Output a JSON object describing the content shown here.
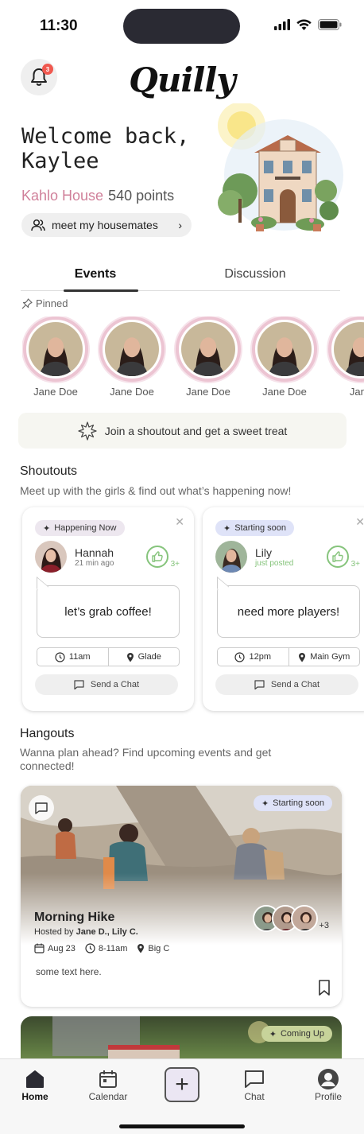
{
  "status": {
    "time": "11:30"
  },
  "header": {
    "logo": "Quilly",
    "notification_count": "3"
  },
  "welcome": {
    "greeting": "Welcome back, Kaylee",
    "house_name": "Kahlo House",
    "points": "540 points",
    "housemates_label": "meet my housemates"
  },
  "tabs": [
    {
      "label": "Events"
    },
    {
      "label": "Discussion"
    }
  ],
  "pinned": {
    "label": "Pinned",
    "people": [
      {
        "name": "Jane Doe"
      },
      {
        "name": "Jane Doe"
      },
      {
        "name": "Jane Doe"
      },
      {
        "name": "Jane Doe"
      },
      {
        "name": "Jane"
      }
    ]
  },
  "join_banner": "Join a shoutout and get a sweet treat",
  "shoutouts": {
    "title": "Shoutouts",
    "subtitle": "Meet up with the girls & find out what’s happening now!",
    "cards": [
      {
        "status": "Happening Now",
        "status_color": "#ede7ef",
        "name": "Hannah",
        "time": "21 min ago",
        "message": "let’s grab coffee!",
        "meet_time": "11am",
        "location": "Glade",
        "likes": "3+",
        "chat_label": "Send a Chat"
      },
      {
        "status": "Starting soon",
        "status_color": "#dfe3f8",
        "name": "Lily",
        "time": "just posted",
        "message": "need more players!",
        "meet_time": "12pm",
        "location": "Main Gym",
        "likes": "3+",
        "chat_label": "Send a Chat"
      }
    ]
  },
  "hangouts": {
    "title": "Hangouts",
    "subtitle": "Wanna plan ahead? Find upcoming events and get connected!",
    "card": {
      "status": "Starting soon",
      "title": "Morning Hike",
      "hosted_prefix": "Hosted by",
      "hosts": "Jane D., Lily C.",
      "date": "Aug 23",
      "time": "8-11am",
      "location": "Big C",
      "text": "some text here.",
      "more_count": "+3"
    },
    "next_card_status": "Coming Up"
  },
  "nav": [
    {
      "label": "Home"
    },
    {
      "label": "Calendar"
    },
    {
      "label": "Chat"
    },
    {
      "label": "Profile"
    }
  ]
}
